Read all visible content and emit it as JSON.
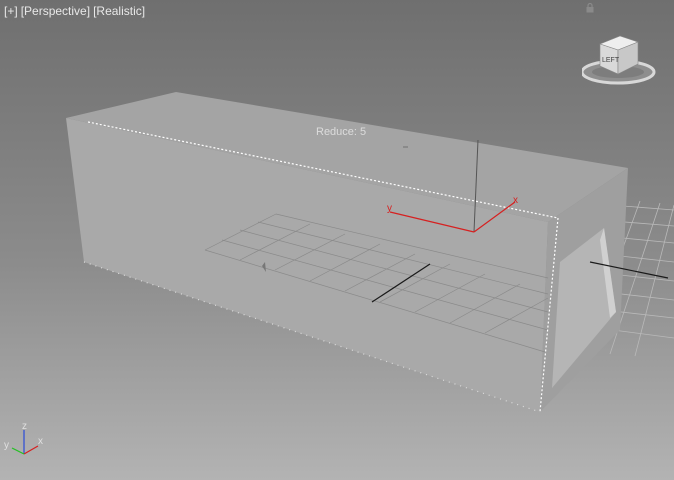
{
  "viewport": {
    "labels": {
      "plus": "[+]",
      "view": "[Perspective]",
      "shading": "[Realistic]"
    },
    "overlay_text": "Reduce: 5",
    "viewcube": {
      "face_label": "LEFT",
      "icon": "viewcube-icon"
    },
    "axis_tripod": {
      "x": "x",
      "y": "y",
      "z": "z"
    },
    "gizmo": {
      "x": "x",
      "y": "y"
    },
    "colors": {
      "background_top": "#6f6f6f",
      "background_bottom": "#b3b3b3",
      "box_face": "#a8a8a8",
      "selection_outline": "#ffffff",
      "x_axis": "#d62020",
      "y_axis": "#22c022",
      "z_axis": "#2a4bd8"
    }
  }
}
